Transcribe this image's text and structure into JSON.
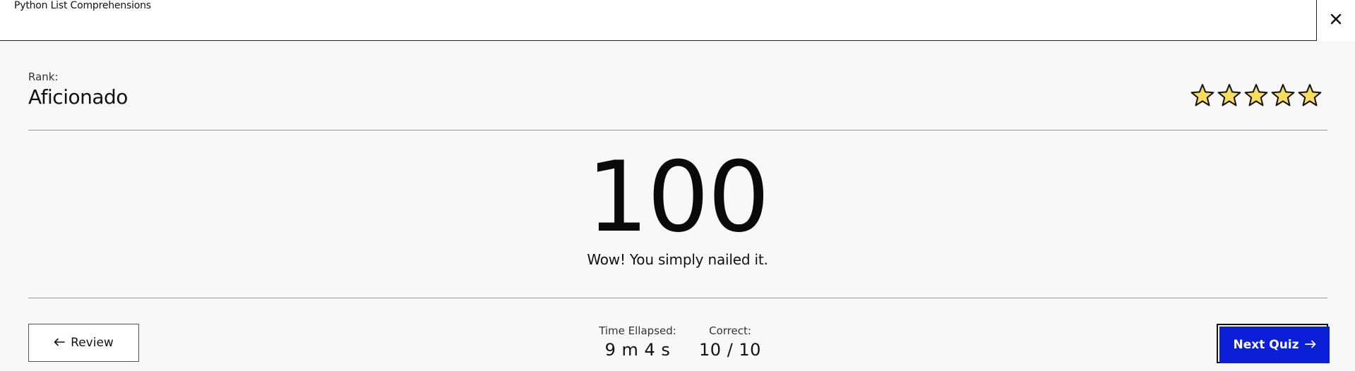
{
  "header": {
    "title": "Python List Comprehensions",
    "close_icon": "close-icon"
  },
  "rank": {
    "label": "Rank:",
    "value": "Aficionado"
  },
  "rating": {
    "stars": 5,
    "max": 5,
    "star_color": "#f7dc5f"
  },
  "score": {
    "value": "100",
    "message": "Wow! You simply nailed it."
  },
  "stats": {
    "time_label": "Time Ellapsed:",
    "time_value": "9 m 4 s",
    "correct_label": "Correct:",
    "correct_value": "10 / 10"
  },
  "actions": {
    "review_label": "Review",
    "review_icon": "arrow-left-icon",
    "next_label": "Next Quiz",
    "next_icon": "arrow-right-icon",
    "next_color": "#0a1fd6"
  }
}
